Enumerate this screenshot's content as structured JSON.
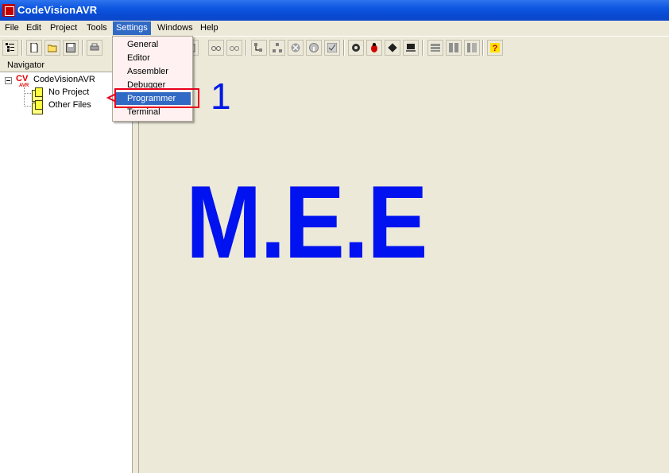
{
  "window": {
    "title": "CodeVisionAVR"
  },
  "menubar": {
    "items": [
      {
        "label": "File"
      },
      {
        "label": "Edit"
      },
      {
        "label": "Project"
      },
      {
        "label": "Tools"
      },
      {
        "label": "Settings"
      },
      {
        "label": "Windows"
      },
      {
        "label": "Help"
      }
    ]
  },
  "settings_menu": {
    "items": [
      {
        "label": "General"
      },
      {
        "label": "Editor"
      },
      {
        "label": "Assembler"
      },
      {
        "label": "Debugger"
      },
      {
        "label": "Programmer"
      },
      {
        "label": "Terminal"
      }
    ],
    "highlighted": "Programmer"
  },
  "navigator": {
    "title": "Navigator",
    "root": {
      "label": "CodeVisionAVR",
      "logo_text": "CV AVR"
    },
    "children": [
      {
        "label": "No Project"
      },
      {
        "label": "Other Files"
      }
    ]
  },
  "annotation": {
    "step_number": "1"
  },
  "watermark": {
    "text": "M.E.E"
  },
  "colors": {
    "titlebar": "#0a4bd4",
    "selection": "#316ac5",
    "annotation_blue": "#0012f0",
    "highlight_red": "#e8001c"
  },
  "toolbar_icons": [
    "navigator-icon",
    "new-file-icon",
    "open-folder-icon",
    "save-icon",
    "print-icon",
    "find-icon",
    "find-replace-icon",
    "tree-icon",
    "tree-alt-icon",
    "stop-icon",
    "info-icon",
    "check-icon",
    "gear-icon",
    "bug-icon",
    "chip-icon",
    "computer-icon",
    "layout-icon",
    "columns-icon",
    "panel-icon",
    "help-icon"
  ]
}
